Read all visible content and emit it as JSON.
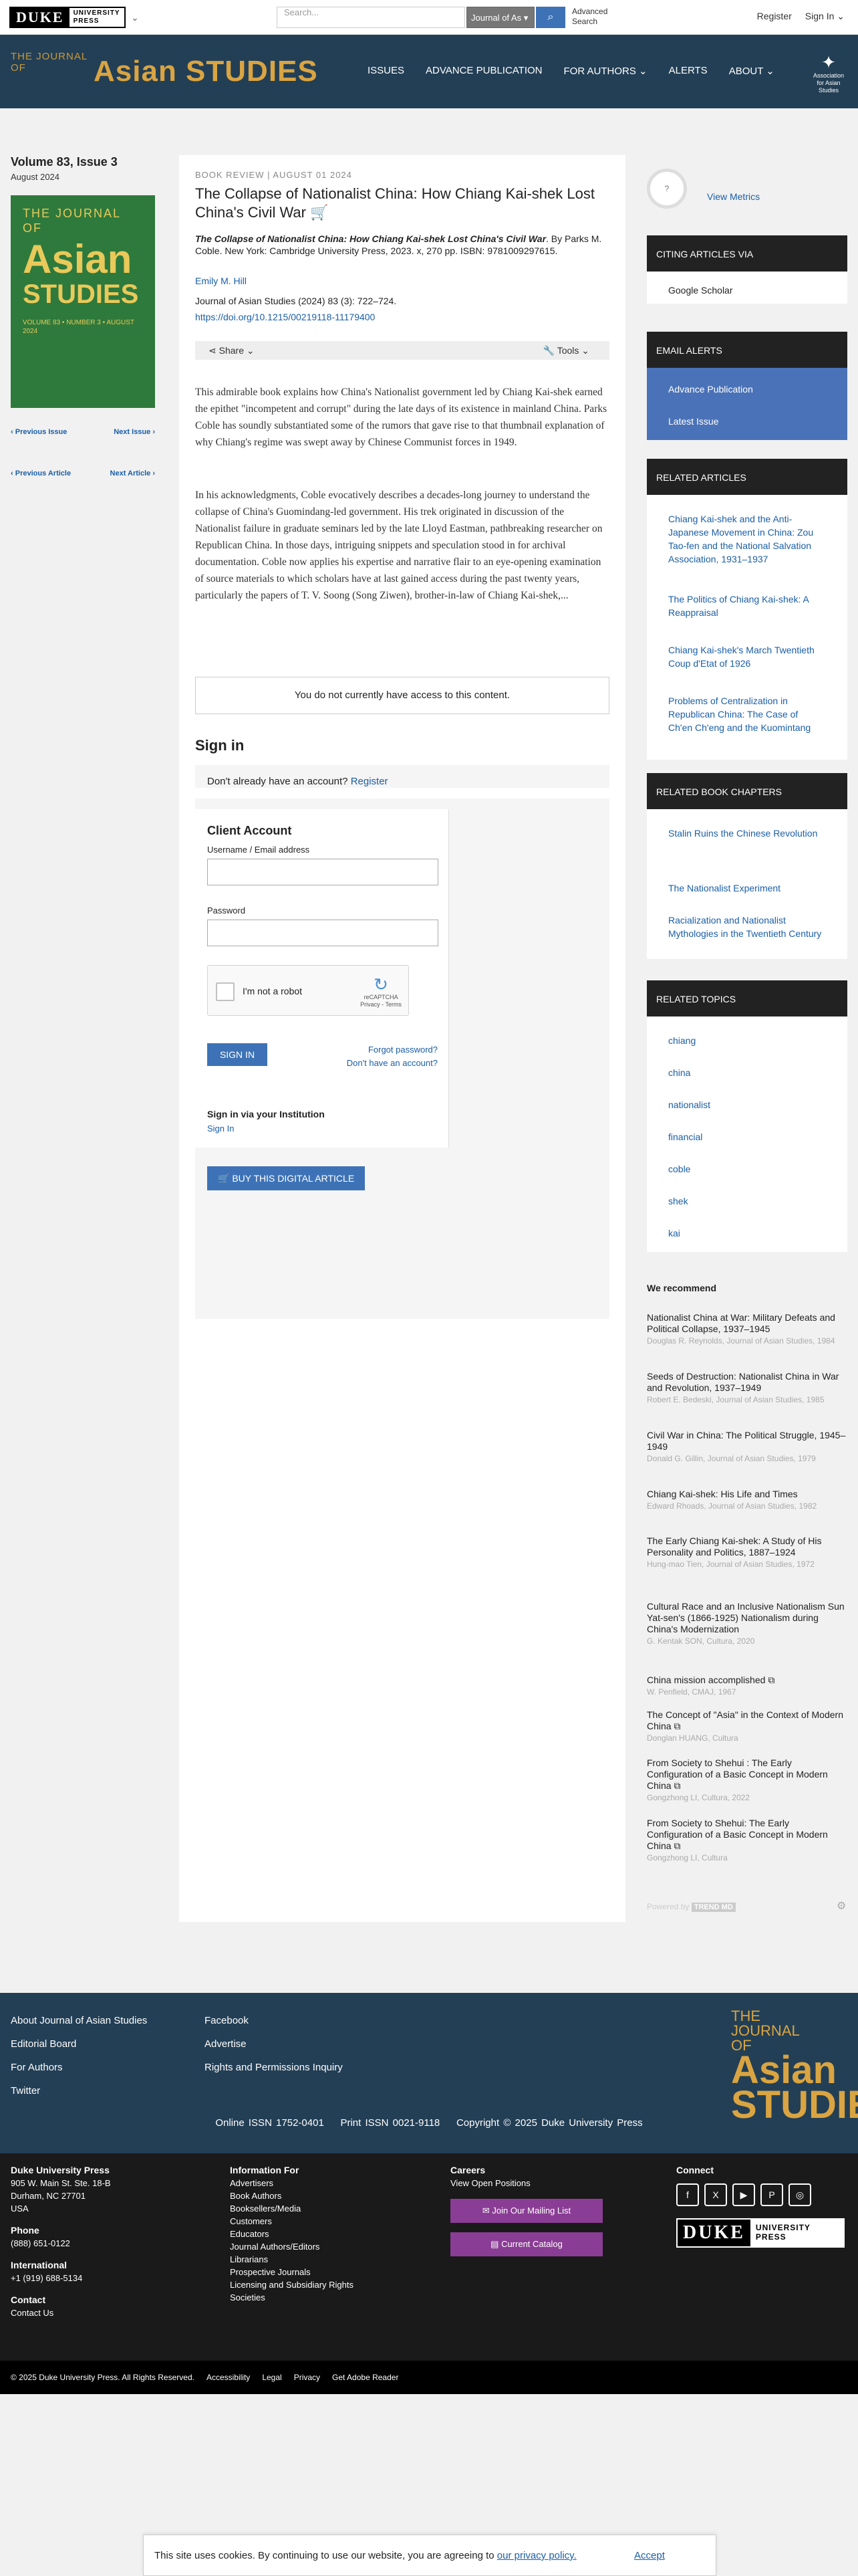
{
  "topbar": {
    "logo_main": "DUKE",
    "logo_sub1": "UNIVERSITY",
    "logo_sub2": "PRESS",
    "search_placeholder": "Search...",
    "search_scope": "Journal of As",
    "advanced_search_1": "Advanced",
    "advanced_search_2": "Search",
    "register": "Register",
    "sign_in": "Sign In"
  },
  "journal_header": {
    "logo_small1": "THE JOURNAL",
    "logo_small2": "OF",
    "logo_big": "Asian STUDIES",
    "nav": [
      "ISSUES",
      "ADVANCE PUBLICATION",
      "FOR AUTHORS",
      "ALERTS",
      "ABOUT"
    ],
    "aas_text": "Association for Asian Studies"
  },
  "issue": {
    "volume": "Volume 83, Issue 3",
    "date": "August 2024",
    "cover_t1": "THE JOURNAL",
    "cover_t1b": "OF",
    "cover_t2": "Asian",
    "cover_t3": "STUDIES",
    "cover_t4": "VOLUME 83 • NUMBER 3 • AUGUST 2024",
    "prev_issue": "Previous Issue",
    "next_issue": "Next Issue",
    "prev_article": "Previous Article",
    "next_article": "Next Article"
  },
  "article": {
    "meta": "BOOK REVIEW | AUGUST 01 2024",
    "title": "The Collapse of Nationalist China: How Chiang Kai-shek Lost China's Civil War",
    "citation_title": "The Collapse of Nationalist China: How Chiang Kai-shek Lost China's Civil War",
    "citation_rest": ". By Parks M. Coble. New York: Cambridge University Press, 2023. x, 270 pp. ISBN: 9781009297615.",
    "author": "Emily M. Hill",
    "journal_cite": "Journal of Asian Studies (2024) 83 (3): 722–724.",
    "doi": "https://doi.org/10.1215/00219118-11179400",
    "share": "Share",
    "tools": "Tools",
    "para1": "This admirable book explains how China's Nationalist government led by Chiang Kai-shek earned the epithet \"incompetent and corrupt\" during the late days of its existence in mainland China. Parks Coble has soundly substantiated some of the rumors that gave rise to that thumbnail explanation of why Chiang's regime was swept away by Chinese Communist forces in 1949.",
    "para2": "In his acknowledgments, Coble evocatively describes a decades-long journey to understand the collapse of China's Guomindang-led government. His trek originated in discussion of the Nationalist failure in graduate seminars led by the late Lloyd Eastman, pathbreaking researcher on Republican China. In those days, intriguing snippets and speculation stood in for archival documentation. Coble now applies his expertise and narrative flair to an eye-opening examination of source materials to which scholars have at last gained access during the past twenty years, particularly the papers of T. V. Soong (Song Ziwen), brother-in-law of Chiang Kai-shek,...",
    "no_access": "You do not currently have access to this content."
  },
  "signin": {
    "heading": "Sign in",
    "no_account": "Don't already have an account?",
    "register": "Register",
    "client_heading": "Client Account",
    "username_label": "Username / Email address",
    "password_label": "Password",
    "captcha_text": "I'm not a robot",
    "captcha_brand": "reCAPTCHA",
    "captcha_terms": "Privacy - Terms",
    "button": "SIGN IN",
    "forgot": "Forgot password?",
    "no_account_link": "Don't have an account?",
    "institution_heading": "Sign in via your Institution",
    "institution_link": "Sign In",
    "buy": "BUY THIS DIGITAL ARTICLE"
  },
  "sidebar": {
    "metrics_badge": "?",
    "metrics_link": "View Metrics",
    "citing_heading": "CITING ARTICLES VIA",
    "citing_items": [
      "Google Scholar"
    ],
    "alerts_heading": "EMAIL ALERTS",
    "alerts_items": [
      "Advance Publication",
      "Latest Issue"
    ],
    "related_articles_heading": "RELATED ARTICLES",
    "related_articles": [
      "Chiang Kai-shek and the Anti-Japanese Movement in China: Zou Tao-fen and the National Salvation Association, 1931–1937",
      "The Politics of Chiang Kai-shek: A Reappraisal",
      "Chiang Kai-shek's March Twentieth Coup d'Etat of 1926",
      "Problems of Centralization in Republican China: The Case of Ch'en Ch'eng and the Kuomintang"
    ],
    "related_chapters_heading": "RELATED BOOK CHAPTERS",
    "related_chapters": [
      "Stalin Ruins the Chinese Revolution",
      "The Nationalist Experiment",
      "Racialization and Nationalist Mythologies in the Twentieth Century"
    ],
    "related_topics_heading": "RELATED TOPICS",
    "related_topics": [
      "chiang",
      "china",
      "nationalist",
      "financial",
      "coble",
      "shek",
      "kai"
    ]
  },
  "recommend": {
    "heading": "We recommend",
    "items": [
      {
        "title": "Nationalist China at War: Military Defeats and Political Collapse, 1937–1945",
        "source": "Douglas R. Reynolds, Journal of Asian Studies, 1984"
      },
      {
        "title": "Seeds of Destruction: Nationalist China in War and Revolution, 1937–1949",
        "source": "Robert E. Bedeski, Journal of Asian Studies, 1985"
      },
      {
        "title": "Civil War in China: The Political Struggle, 1945–1949",
        "source": "Donald G. Gillin, Journal of Asian Studies, 1979"
      },
      {
        "title": "Chiang Kai-shek: His Life and Times",
        "source": "Edward Rhoads, Journal of Asian Studies, 1982"
      },
      {
        "title": "The Early Chiang Kai-shek: A Study of His Personality and Politics, 1887–1924",
        "source": "Hung-mao Tien, Journal of Asian Studies, 1972"
      },
      {
        "title": "Cultural Race and an Inclusive Nationalism Sun Yat-sen's (1866-1925) Nationalism during China's Modernization",
        "source": "G. Kentak SON, Cultura, 2020"
      },
      {
        "title": "China mission accomplished",
        "source": "W. Penfield, CMAJ, 1967"
      },
      {
        "title": "The Concept of \"Asia\" in the Context of Modern China",
        "source": "Donglan HUANG, Cultura"
      },
      {
        "title": "From Society to Shehui : The Early Configuration of a Basic Concept in Modern China",
        "source": "Gongzhong LI, Cultura, 2022"
      },
      {
        "title": "From Society to Shehui: The Early Configuration of a Basic Concept in Modern China",
        "source": "Gongzhong LI, Cultura"
      }
    ],
    "powered_by": "Powered by",
    "trendmd": "TREND MD"
  },
  "footer": {
    "col1": [
      "About Journal of Asian Studies",
      "Editorial Board",
      "For Authors",
      "Twitter"
    ],
    "col2": [
      "Facebook",
      "Advertise",
      "Rights and Permissions Inquiry"
    ],
    "logo_a1": "THE",
    "logo_a2": "JOURNAL",
    "logo_a3": "OF",
    "logo_b1": "Asian",
    "logo_b2": "STUDIES",
    "online_issn": "Online ISSN 1752-0401",
    "print_issn": "Print ISSN 0021-9118",
    "copyright": "Copyright © 2025 Duke University Press",
    "dup_heading": "Duke University Press",
    "address": [
      "905 W. Main St. Ste. 18-B",
      "Durham, NC 27701",
      "USA"
    ],
    "phone_heading": "Phone",
    "phone": "(888) 651-0122",
    "intl_heading": "International",
    "intl": "+1 (919) 688-5134",
    "contact_heading": "Contact",
    "contact": "Contact Us",
    "info_heading": "Information For",
    "info_items": [
      "Advertisers",
      "Book Authors",
      "Booksellers/Media",
      "Customers",
      "Educators",
      "Journal Authors/Editors",
      "Librarians",
      "Prospective Journals",
      "Licensing and Subsidiary Rights",
      "Societies"
    ],
    "careers_heading": "Careers",
    "careers_link": "View Open Positions",
    "mailing_btn": "Join Our Mailing List",
    "catalog_btn": "Current Catalog",
    "connect_heading": "Connect",
    "social": [
      "f",
      "X",
      "▶",
      "P",
      "◎"
    ],
    "duke_main": "DUKE",
    "duke_sub1": "UNIVERSITY",
    "duke_sub2": "PRESS",
    "bottom": [
      "© 2025 Duke University Press. All Rights Reserved.",
      "Accessibility",
      "Legal",
      "Privacy",
      "Get Adobe Reader"
    ]
  },
  "cookie": {
    "text": "This site uses cookies. By continuing to use our website, you are agreeing to",
    "policy": "our privacy policy.",
    "accept": "Accept"
  },
  "colors": {
    "header_bg": "#233f55",
    "accent_gold": "#d9a441",
    "link_blue": "#1a5ea8",
    "button_blue": "#3d73b6",
    "alerts_blue": "#4a72b8"
  }
}
